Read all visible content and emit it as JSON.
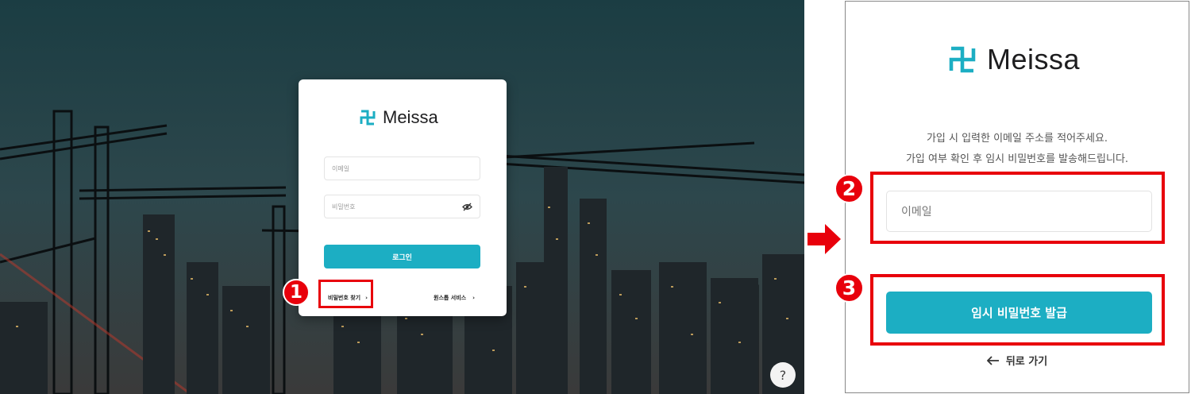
{
  "brand": {
    "name": "Meissa",
    "accent": "#1caec3",
    "highlight": "#e8000b"
  },
  "login": {
    "email_placeholder": "이메일",
    "password_placeholder": "비밀번호",
    "login_label": "로그인",
    "find_password_label": "비밀번호 찾기",
    "service_label": "원스톱 서비스",
    "help_label": "?"
  },
  "reset": {
    "description_line1": "가입 시 입력한 이메일 주소를 적어주세요.",
    "description_line2": "가입 여부 확인 후 임시 비밀번호를 발송해드립니다.",
    "email_placeholder": "이메일",
    "issue_button_label": "임시 비밀번호 발급",
    "back_label": "뒤로 가기"
  },
  "steps": [
    "1",
    "2",
    "3"
  ],
  "icons": [
    "meissa-logo-icon",
    "eye-off-icon",
    "chevron-right-icon",
    "arrow-left-icon",
    "right-arrow-icon"
  ]
}
